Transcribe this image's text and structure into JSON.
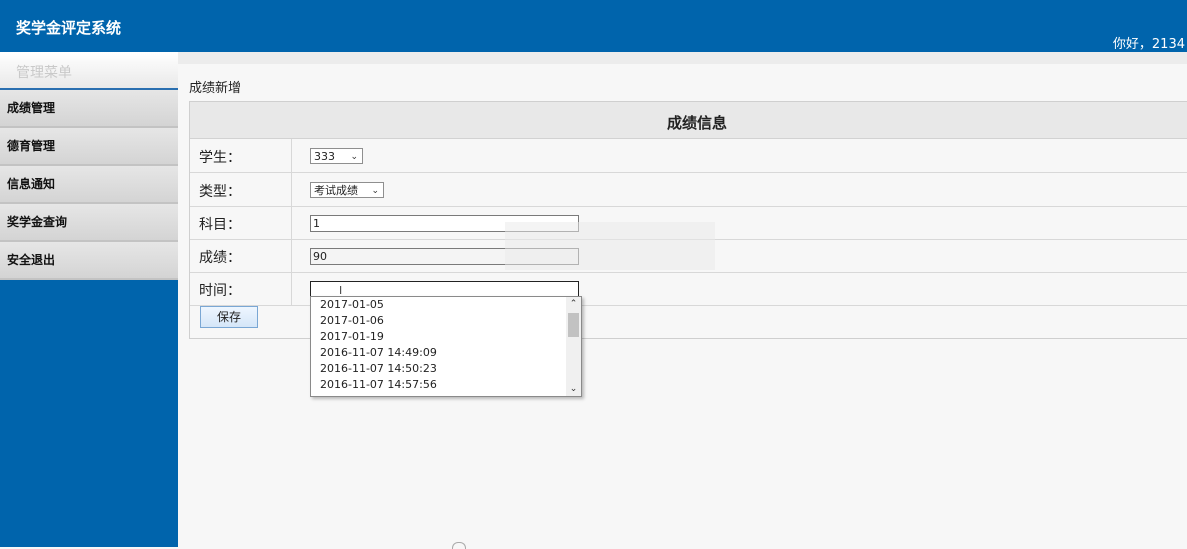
{
  "header": {
    "title": "奖学金评定系统",
    "greeting": "你好，2134"
  },
  "sidebar": {
    "heading": "管理菜单",
    "items": [
      {
        "label": "成绩管理"
      },
      {
        "label": "德育管理"
      },
      {
        "label": "信息通知"
      },
      {
        "label": "奖学金查询"
      },
      {
        "label": "安全退出"
      }
    ]
  },
  "breadcrumb": "成绩新增",
  "form": {
    "title": "成绩信息",
    "student": {
      "label": "学生：",
      "value": "333"
    },
    "type": {
      "label": "类型：",
      "value": "考试成绩"
    },
    "subject": {
      "label": "科目：",
      "value": "1"
    },
    "score": {
      "label": "成绩：",
      "value": "90"
    },
    "time": {
      "label": "时间：",
      "value": ""
    },
    "save_label": "保存"
  },
  "autocomplete": {
    "options": [
      "2017-01-05",
      "2017-01-06",
      "2017-01-19",
      "2016-11-07 14:49:09",
      "2016-11-07 14:50:23",
      "2016-11-07 14:57:56"
    ]
  },
  "colors": {
    "brand": "#0064ac",
    "sidebar_item_bg": "#d9d9d9",
    "panel_header_bg": "#e8e8e8"
  }
}
